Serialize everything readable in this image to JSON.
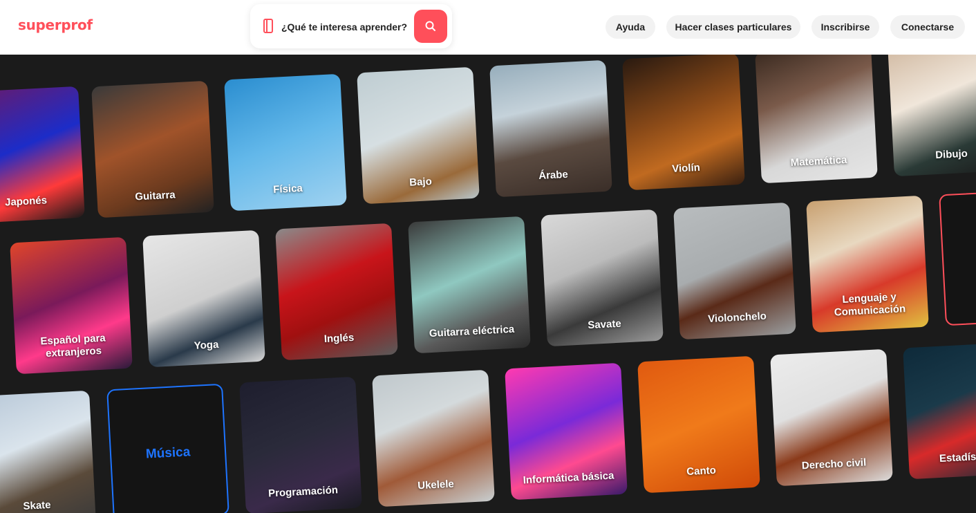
{
  "header": {
    "logo": "superprof",
    "search_placeholder": "¿Qué te interesa aprender?",
    "nav": [
      "Ayuda",
      "Hacer clases particulares",
      "Inscribirse",
      "Conectarse"
    ]
  },
  "colors": {
    "brand": "#ff4f5a",
    "highlight_blue": "#1e74ff"
  },
  "tiles": {
    "row1": [
      "Japonés",
      "Guitarra",
      "Física",
      "Bajo",
      "Árabe",
      "Violín",
      "Matemática",
      "Dibujo"
    ],
    "row2": [
      "Español para extranjeros",
      "Yoga",
      "Inglés",
      "Guitarra eléctrica",
      "Savate",
      "Violonchelo",
      "Lenguaje y Comunicación"
    ],
    "row3": [
      "Skate",
      "Música",
      "Programación",
      "Ukelele",
      "Informática básica",
      "Canto",
      "Derecho civil",
      "Estadística"
    ]
  }
}
